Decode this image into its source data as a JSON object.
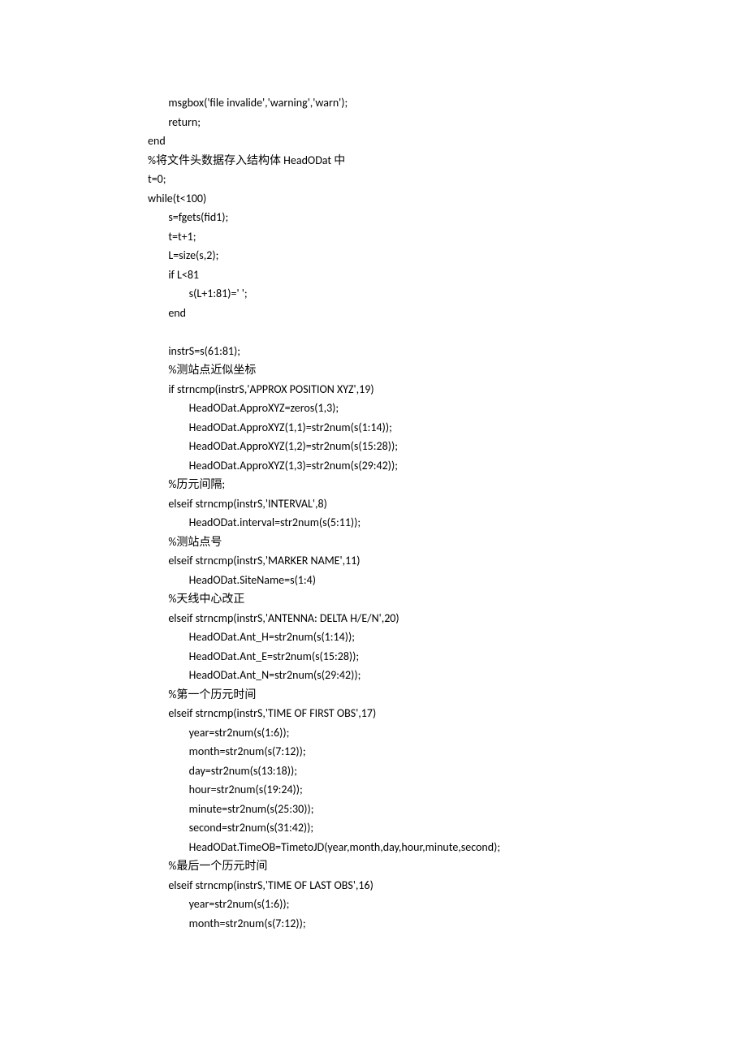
{
  "lines": [
    "        msgbox('file invalide','warning','warn');",
    "        return;",
    "end",
    "%将文件头数据存入结构体 HeadODat 中",
    "t=0;",
    "while(t<100)",
    "        s=fgets(fid1);",
    "        t=t+1;",
    "        L=size(s,2);",
    "        if L<81",
    "                s(L+1:81)=' ';",
    "        end",
    "",
    "        instrS=s(61:81);",
    "        %测站点近似坐标",
    "        if strncmp(instrS,'APPROX POSITION XYZ',19)",
    "                HeadODat.ApproXYZ=zeros(1,3);",
    "                HeadODat.ApproXYZ(1,1)=str2num(s(1:14));",
    "                HeadODat.ApproXYZ(1,2)=str2num(s(15:28));",
    "                HeadODat.ApproXYZ(1,3)=str2num(s(29:42));",
    "        %历元间隔;",
    "        elseif strncmp(instrS,'INTERVAL',8)",
    "                HeadODat.interval=str2num(s(5:11));",
    "        %测站点号",
    "        elseif strncmp(instrS,'MARKER NAME',11)",
    "                HeadODat.SiteName=s(1:4)",
    "        %天线中心改正",
    "        elseif strncmp(instrS,'ANTENNA: DELTA H/E/N',20)",
    "                HeadODat.Ant_H=str2num(s(1:14));",
    "                HeadODat.Ant_E=str2num(s(15:28));",
    "                HeadODat.Ant_N=str2num(s(29:42));",
    "        %第一个历元时间",
    "        elseif strncmp(instrS,'TIME OF FIRST OBS',17)",
    "                year=str2num(s(1:6));",
    "                month=str2num(s(7:12));",
    "                day=str2num(s(13:18));",
    "                hour=str2num(s(19:24));",
    "                minute=str2num(s(25:30));",
    "                second=str2num(s(31:42));",
    "                HeadODat.TimeOB=TimetoJD(year,month,day,hour,minute,second);",
    "        %最后一个历元时间",
    "        elseif strncmp(instrS,'TIME OF LAST OBS',16)",
    "                year=str2num(s(1:6));",
    "                month=str2num(s(7:12));"
  ]
}
